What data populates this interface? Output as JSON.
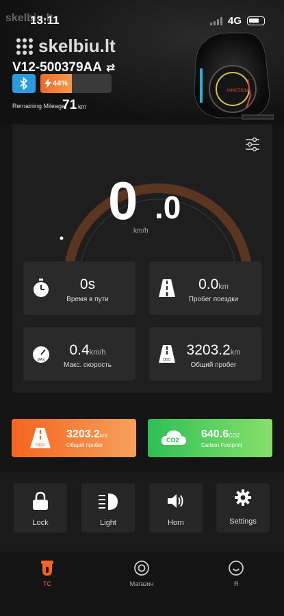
{
  "status_bar": {
    "time": "13:11",
    "network": "4G"
  },
  "watermark": {
    "text": "skelbiu.lt"
  },
  "device": {
    "name": "V12-500379AA",
    "battery_percent": "44%",
    "battery_level": 0.44
  },
  "mileage": {
    "label": "Remaining Mileage",
    "value": "71",
    "unit": "km"
  },
  "speed": {
    "integer": "0",
    "decimal": ".0",
    "unit": "km/h"
  },
  "stats": [
    {
      "value": "0s",
      "unit": "",
      "label": "Время в пути",
      "icon": "stopwatch-icon"
    },
    {
      "value": "0.0",
      "unit": "km",
      "label": "Пробег поездки",
      "icon": "road-icon"
    },
    {
      "value": "0.4",
      "unit": "km/h",
      "label": "Макс. скорость",
      "icon": "max-speed-gauge-icon"
    },
    {
      "value": "3203.2",
      "unit": "km",
      "label": "Общий пробег",
      "icon": "odometer-road-icon"
    }
  ],
  "summary_cards": [
    {
      "value": "3203.2",
      "unit": "km",
      "label": "Общий пробег",
      "icon": "odometer-road-icon",
      "color": "#f5651f"
    },
    {
      "value": "640.6",
      "unit": "CO2",
      "label": "Carbon Footprint",
      "icon": "co2-cloud-icon",
      "color": "#2fbf55"
    }
  ],
  "controls": [
    {
      "label": "Lock",
      "icon": "lock-icon"
    },
    {
      "label": "Light",
      "icon": "headlight-icon"
    },
    {
      "label": "Horn",
      "icon": "horn-icon"
    },
    {
      "label": "Settings",
      "icon": "gear-icon"
    }
  ],
  "tabs": [
    {
      "label": "TC",
      "icon": "unicycle-icon",
      "active": true
    },
    {
      "label": "Магазин",
      "icon": "shop-icon",
      "active": false
    },
    {
      "label": "Я",
      "icon": "profile-smile-icon",
      "active": false
    }
  ],
  "colors": {
    "accent": "#f5651f",
    "green": "#2fbf55",
    "gauge_arc": "#5a3520",
    "bluetooth": "#2b9be0"
  }
}
